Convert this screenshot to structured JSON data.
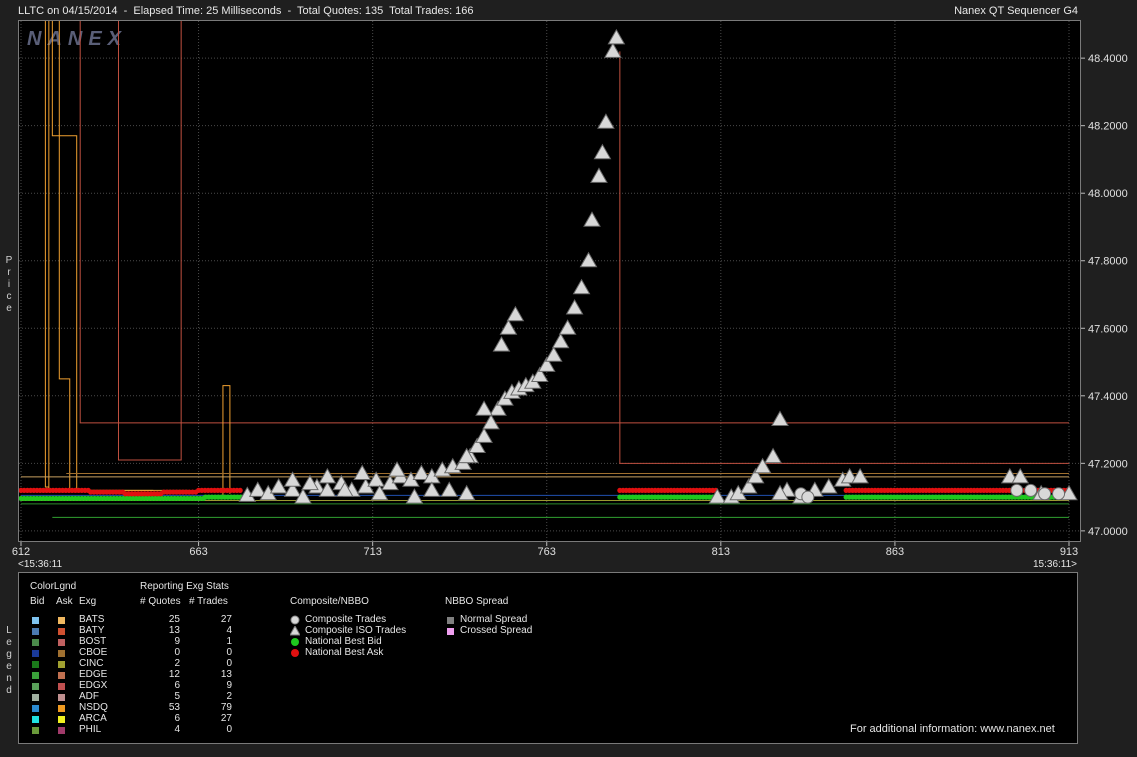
{
  "header": {
    "left": "LLTC on 04/15/2014  -  Elapsed Time: 25 Milliseconds  -  Total Quotes: 135  Total Trades: 166",
    "right": "Nanex QT Sequencer G4"
  },
  "watermark": "NANEX",
  "side_labels": {
    "price": [
      "P",
      "r",
      "i",
      "c",
      "e"
    ],
    "legend": [
      "L",
      "e",
      "g",
      "e",
      "n",
      "d"
    ]
  },
  "x_axis": {
    "ticks": [
      "612",
      "663",
      "713",
      "763",
      "813",
      "863",
      "913"
    ],
    "start_time": "<15:36:11",
    "end_time": "15:36:11>"
  },
  "chart_data": {
    "type": "scatter",
    "y_axis": {
      "ticks": [
        "48.4000",
        "48.2000",
        "48.0000",
        "47.8000",
        "47.6000",
        "47.4000",
        "47.2000",
        "47.0000"
      ],
      "ylim": [
        46.97,
        48.51
      ]
    },
    "xlim": [
      612,
      913
    ],
    "grid": true,
    "series": [
      {
        "name": "Composite ISO Trades",
        "marker": "triangle",
        "color": "#d8d8d8",
        "points": [
          [
            677,
            47.105
          ],
          [
            680,
            47.12
          ],
          [
            683,
            47.11
          ],
          [
            686,
            47.13
          ],
          [
            690,
            47.12
          ],
          [
            693,
            47.1
          ],
          [
            697,
            47.13
          ],
          [
            700,
            47.12
          ],
          [
            704,
            47.14
          ],
          [
            707,
            47.12
          ],
          [
            711,
            47.13
          ],
          [
            714,
            47.15
          ],
          [
            718,
            47.14
          ],
          [
            721,
            47.16
          ],
          [
            724,
            47.15
          ],
          [
            727,
            47.17
          ],
          [
            730,
            47.16
          ],
          [
            733,
            47.18
          ],
          [
            736,
            47.19
          ],
          [
            739,
            47.2
          ],
          [
            741,
            47.22
          ],
          [
            743,
            47.25
          ],
          [
            745,
            47.28
          ],
          [
            747,
            47.32
          ],
          [
            749,
            47.36
          ],
          [
            751,
            47.39
          ],
          [
            753,
            47.41
          ],
          [
            755,
            47.42
          ],
          [
            757,
            47.43
          ],
          [
            759,
            47.44
          ],
          [
            761,
            47.46
          ],
          [
            763,
            47.49
          ],
          [
            765,
            47.52
          ],
          [
            767,
            47.56
          ],
          [
            769,
            47.6
          ],
          [
            771,
            47.66
          ],
          [
            773,
            47.72
          ],
          [
            775,
            47.8
          ],
          [
            776,
            47.92
          ],
          [
            778,
            48.05
          ],
          [
            779,
            48.12
          ],
          [
            780,
            48.21
          ],
          [
            782,
            48.42
          ],
          [
            783,
            48.46
          ],
          [
            740,
            47.22
          ],
          [
            745,
            47.36
          ],
          [
            750,
            47.55
          ],
          [
            752,
            47.6
          ],
          [
            754,
            47.64
          ],
          [
            735,
            47.12
          ],
          [
            725,
            47.1
          ],
          [
            715,
            47.11
          ],
          [
            705,
            47.12
          ],
          [
            695,
            47.14
          ],
          [
            690,
            47.15
          ],
          [
            700,
            47.16
          ],
          [
            710,
            47.17
          ],
          [
            720,
            47.18
          ],
          [
            730,
            47.12
          ],
          [
            740,
            47.11
          ],
          [
            812,
            47.1
          ],
          [
            816,
            47.1
          ],
          [
            818,
            47.11
          ],
          [
            821,
            47.13
          ],
          [
            823,
            47.16
          ],
          [
            825,
            47.19
          ],
          [
            828,
            47.22
          ],
          [
            830,
            47.33
          ],
          [
            832,
            47.12
          ],
          [
            836,
            47.1
          ],
          [
            840,
            47.12
          ],
          [
            844,
            47.13
          ],
          [
            848,
            47.15
          ],
          [
            850,
            47.16
          ],
          [
            853,
            47.16
          ],
          [
            896,
            47.16
          ],
          [
            899,
            47.16
          ],
          [
            913,
            47.11
          ],
          [
            905,
            47.11
          ],
          [
            830,
            47.11
          ]
        ]
      },
      {
        "name": "Composite Trades",
        "marker": "circle",
        "color": "#d8d8d8",
        "points": [
          [
            836,
            47.11
          ],
          [
            838,
            47.1
          ],
          [
            898,
            47.12
          ],
          [
            902,
            47.12
          ],
          [
            906,
            47.11
          ],
          [
            910,
            47.11
          ]
        ]
      },
      {
        "name": "National Best Bid",
        "marker": "dot",
        "color": "#1ec81e",
        "segments": [
          [
            612,
            665,
            47.096
          ],
          [
            665,
            678,
            47.1
          ],
          [
            784,
            812,
            47.1
          ],
          [
            849,
            893,
            47.1
          ],
          [
            893,
            913,
            47.1
          ]
        ]
      },
      {
        "name": "National Best Ask",
        "marker": "dot",
        "color": "#e01010",
        "segments": [
          [
            612,
            632,
            47.12
          ],
          [
            632,
            642,
            47.115
          ],
          [
            642,
            653,
            47.11
          ],
          [
            653,
            663,
            47.115
          ],
          [
            663,
            675,
            47.12
          ],
          [
            784,
            812,
            47.12
          ],
          [
            849,
            913,
            47.12
          ]
        ]
      }
    ],
    "exchange_lines": [
      {
        "color": "#f0a030",
        "points": [
          [
            619,
            48.6
          ],
          [
            619,
            47.13
          ],
          [
            620,
            47.13
          ]
        ]
      },
      {
        "color": "#f0a030",
        "points": [
          [
            620,
            48.6
          ],
          [
            620,
            47.12
          ],
          [
            650,
            47.12
          ]
        ]
      },
      {
        "color": "#f0a030",
        "points": [
          [
            621,
            48.6
          ],
          [
            621,
            48.17
          ],
          [
            628,
            48.17
          ],
          [
            628,
            47.12
          ],
          [
            660,
            47.12
          ]
        ]
      },
      {
        "color": "#f0a030",
        "points": [
          [
            623,
            48.6
          ],
          [
            623,
            47.45
          ],
          [
            626,
            47.45
          ],
          [
            626,
            47.12
          ]
        ]
      },
      {
        "color": "#c05040",
        "points": [
          [
            629,
            48.6
          ],
          [
            629,
            47.32
          ],
          [
            913,
            47.32
          ]
        ]
      },
      {
        "color": "#c05040",
        "points": [
          [
            640,
            48.6
          ],
          [
            640,
            47.21
          ],
          [
            658,
            47.21
          ],
          [
            658,
            48.6
          ]
        ]
      },
      {
        "color": "#f0a030",
        "points": [
          [
            670,
            47.1
          ],
          [
            670,
            47.43
          ],
          [
            672,
            47.43
          ],
          [
            672,
            47.11
          ]
        ]
      },
      {
        "color": "#c05040",
        "points": [
          [
            784,
            48.42
          ],
          [
            784,
            47.2
          ],
          [
            913,
            47.2
          ]
        ]
      },
      {
        "color": "#c8a060",
        "points": [
          [
            612,
            47.16
          ],
          [
            913,
            47.16
          ]
        ]
      },
      {
        "color": "#a07030",
        "points": [
          [
            625,
            47.17
          ],
          [
            913,
            47.17
          ]
        ]
      },
      {
        "color": "#2050b0",
        "points": [
          [
            612,
            47.105
          ],
          [
            913,
            47.105
          ]
        ]
      },
      {
        "color": "#2a8a2a",
        "points": [
          [
            612,
            47.08
          ],
          [
            913,
            47.08
          ]
        ]
      },
      {
        "color": "#30a030",
        "points": [
          [
            621,
            47.04
          ],
          [
            913,
            47.04
          ]
        ]
      },
      {
        "color": "#9a9a30",
        "points": [
          [
            612,
            47.09
          ],
          [
            913,
            47.09
          ]
        ]
      }
    ]
  },
  "legend": {
    "titles": {
      "colorlgnd": "ColorLgnd",
      "stats": "Reporting Exg Stats",
      "composite": "Composite/NBBO",
      "spread": "NBBO Spread"
    },
    "headers": {
      "bid": "Bid",
      "ask": "Ask",
      "exg": "Exg",
      "quotes": "# Quotes",
      "trades": "# Trades"
    },
    "rows": [
      {
        "exg": "BATS",
        "bid": "#7fc4f0",
        "ask": "#f0b860",
        "quotes": "25",
        "trades": "27"
      },
      {
        "exg": "BATY",
        "bid": "#4a7ab0",
        "ask": "#d05030",
        "quotes": "13",
        "trades": "4"
      },
      {
        "exg": "BOST",
        "bid": "#4a8a4a",
        "ask": "#c06060",
        "quotes": "9",
        "trades": "1"
      },
      {
        "exg": "CBOE",
        "bid": "#1a3a9a",
        "ask": "#a07030",
        "quotes": "0",
        "trades": "0"
      },
      {
        "exg": "CINC",
        "bid": "#1a7a1a",
        "ask": "#a0a030",
        "quotes": "2",
        "trades": "0"
      },
      {
        "exg": "EDGE",
        "bid": "#3aa03a",
        "ask": "#c07050",
        "quotes": "12",
        "trades": "13"
      },
      {
        "exg": "EDGX",
        "bid": "#5aa05a",
        "ask": "#c05050",
        "quotes": "6",
        "trades": "9"
      },
      {
        "exg": "ADF",
        "bid": "#a0b0a0",
        "ask": "#c09090",
        "quotes": "5",
        "trades": "2"
      },
      {
        "exg": "NSDQ",
        "bid": "#2a8ad0",
        "ask": "#f09a20",
        "quotes": "53",
        "trades": "79"
      },
      {
        "exg": "ARCA",
        "bid": "#20e0e0",
        "ask": "#f0f020",
        "quotes": "6",
        "trades": "27"
      },
      {
        "exg": "PHIL",
        "bid": "#6a9a3a",
        "ask": "#a03a6a",
        "quotes": "4",
        "trades": "0"
      }
    ],
    "composite_items": [
      "Composite Trades",
      "Composite ISO Trades",
      "National Best Bid",
      "National Best Ask"
    ],
    "spread_items": [
      {
        "label": "Normal Spread",
        "color": "#808080"
      },
      {
        "label": "Crossed Spread",
        "color": "#f0a0f0"
      }
    ],
    "footer": "For additional information: www.nanex.net"
  }
}
